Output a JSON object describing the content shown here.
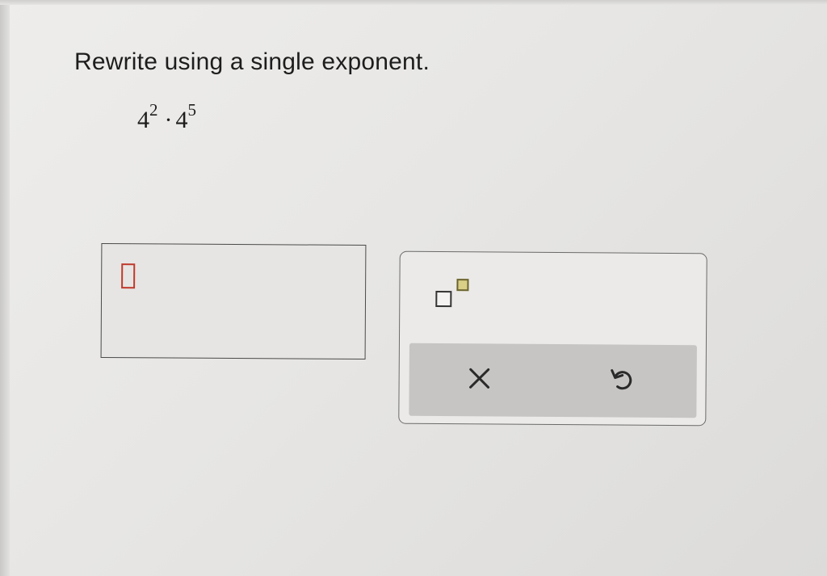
{
  "question": {
    "instruction": "Rewrite using a single exponent.",
    "expression": {
      "term1_base": "4",
      "term1_exponent": "2",
      "operator": "·",
      "term2_base": "4",
      "term2_exponent": "5"
    }
  },
  "answer": {
    "value": ""
  },
  "keypad": {
    "buttons": [
      {
        "name": "exponent-template",
        "icon": "superscript-template-icon"
      },
      {
        "name": "clear",
        "icon": "close-icon"
      },
      {
        "name": "undo",
        "icon": "undo-icon"
      }
    ]
  },
  "colors": {
    "background": "#e9e8e6",
    "cursor_slot": "#c0392b",
    "action_bar": "#c6c5c3",
    "exponent_highlight": "#d9cf86"
  }
}
